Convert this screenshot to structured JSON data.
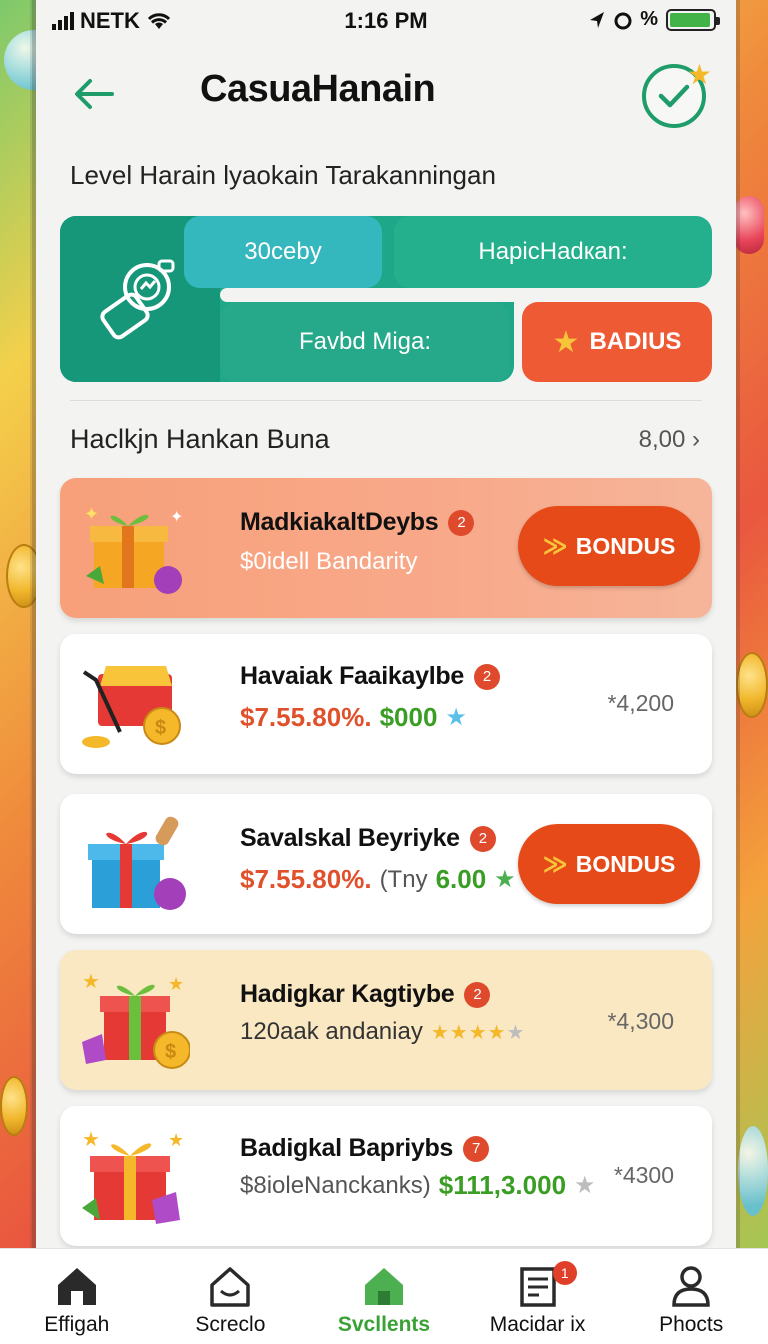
{
  "status_bar": {
    "carrier": "NETK",
    "time": "1:16 PM",
    "battery_symbol": "%",
    "battery_level_pct": 95
  },
  "header": {
    "title": "CasuaHanain"
  },
  "level_title": "Level Harain lyaokain Tarakanningan",
  "panel": {
    "pill_top_left": "30ceby",
    "pill_top_right": "HapicHadкan:",
    "pill_bottom": "Favbd Miga:",
    "action_label": "BADIUS"
  },
  "section": {
    "title": "Haclkjn Hankan Buna",
    "value": "8,00"
  },
  "cards": [
    {
      "title": "MadkiakaltDeybs",
      "badge": "2",
      "subtitle": "$0idell Bandarity",
      "button": "BONDUS"
    },
    {
      "title": "Havaiak Faaikaylbe",
      "badge": "2",
      "price_red": "$7.55.80%.",
      "price_green": "$000",
      "right_value": "*4,200"
    },
    {
      "title": "Savalskal Beyriyke",
      "badge": "2",
      "price_red": "$7.55.80%.",
      "price_gray": "(Tny",
      "price_green": "6.00",
      "button": "BONDUS"
    },
    {
      "title": "Hadigkar Kagtiybe",
      "badge": "2",
      "subtitle": "120aak andaniay",
      "stars": "★★★★",
      "star_empty": "★",
      "rating": 4,
      "right_value": "*4,300"
    },
    {
      "title": "Badigkal Bapriybs",
      "badge": "7",
      "subtitle": "$8ioleNanckanks)",
      "price_green": "$111,3.000",
      "right_value": "*4300"
    }
  ],
  "nav": {
    "items": [
      {
        "label": "Effigah",
        "icon": "home-icon"
      },
      {
        "label": "Screclo",
        "icon": "house-outline-icon"
      },
      {
        "label": "Svcllents",
        "icon": "home-active-icon"
      },
      {
        "label": "Macidar ix",
        "icon": "document-icon",
        "badge": "1"
      },
      {
        "label": "Phocts",
        "icon": "profile-icon"
      }
    ]
  },
  "colors": {
    "accent_green": "#1ea788",
    "accent_orange": "#e64a19",
    "active_nav": "#3aa235"
  }
}
